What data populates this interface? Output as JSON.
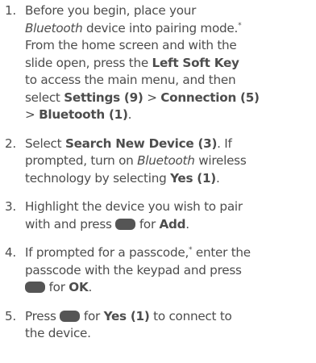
{
  "steps": [
    {
      "number": "1.",
      "lines": [
        [
          "Before you begin, place your"
        ],
        [
          "Bluetooth",
          " device into pairing mode.",
          "*"
        ],
        [
          "From the home screen and with the"
        ],
        [
          "slide open, press the ",
          "Left Soft Key"
        ],
        [
          "to access the main menu, and then"
        ],
        [
          "select ",
          "Settings (9)",
          " > ",
          "Connection (5)"
        ],
        [
          "> ",
          "Bluetooth (1)",
          "."
        ]
      ]
    },
    {
      "number": "2.",
      "lines": [
        [
          "Select ",
          "Search New Device (3)",
          ". If"
        ],
        [
          "prompted, turn on ",
          "Bluetooth",
          " wireless"
        ],
        [
          "technology by selecting ",
          "Yes (1)",
          "."
        ]
      ]
    },
    {
      "number": "3.",
      "lines": [
        [
          "Highlight the device you wish to pair"
        ],
        [
          "with and press ",
          " for ",
          "Add",
          "."
        ]
      ]
    },
    {
      "number": "4.",
      "lines": [
        [
          "If prompted for a passcode,",
          "*",
          " enter the"
        ],
        [
          "passcode with the keypad and press"
        ],
        [
          " for ",
          "OK",
          "."
        ]
      ]
    },
    {
      "number": "5.",
      "lines": [
        [
          "Press ",
          " for ",
          "Yes (1)",
          " to connect to"
        ],
        [
          "the device."
        ]
      ]
    }
  ],
  "icons": {
    "soft_key": "key-button-icon"
  },
  "colors": {
    "text": "#4d4d4d",
    "key": "#555555"
  }
}
